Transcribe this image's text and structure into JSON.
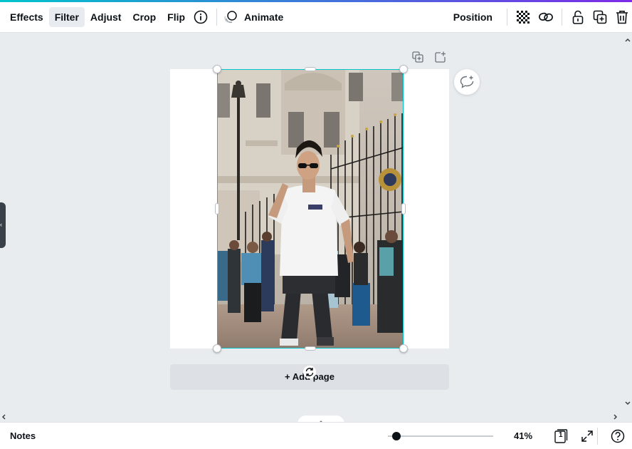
{
  "toolbar": {
    "items": [
      "Effects",
      "Filter",
      "Adjust",
      "Crop",
      "Flip"
    ],
    "active_item": "Filter",
    "animate_label": "Animate",
    "position_label": "Position"
  },
  "canvas": {
    "add_page_label": "+ Add page"
  },
  "footer": {
    "notes_label": "Notes",
    "zoom_level": "41%",
    "zoom_fraction": 0.04,
    "page_count": "1"
  },
  "colors": {
    "selection": "#00c4cc",
    "accent_start": "#00c4cc",
    "accent_end": "#7d2ae8"
  },
  "icons": {
    "info": "info-icon",
    "animate": "animate-icon",
    "transparency": "transparency-icon",
    "link": "link-icon",
    "lock": "lock-icon",
    "duplicate": "duplicate-icon",
    "delete": "trash-icon"
  }
}
